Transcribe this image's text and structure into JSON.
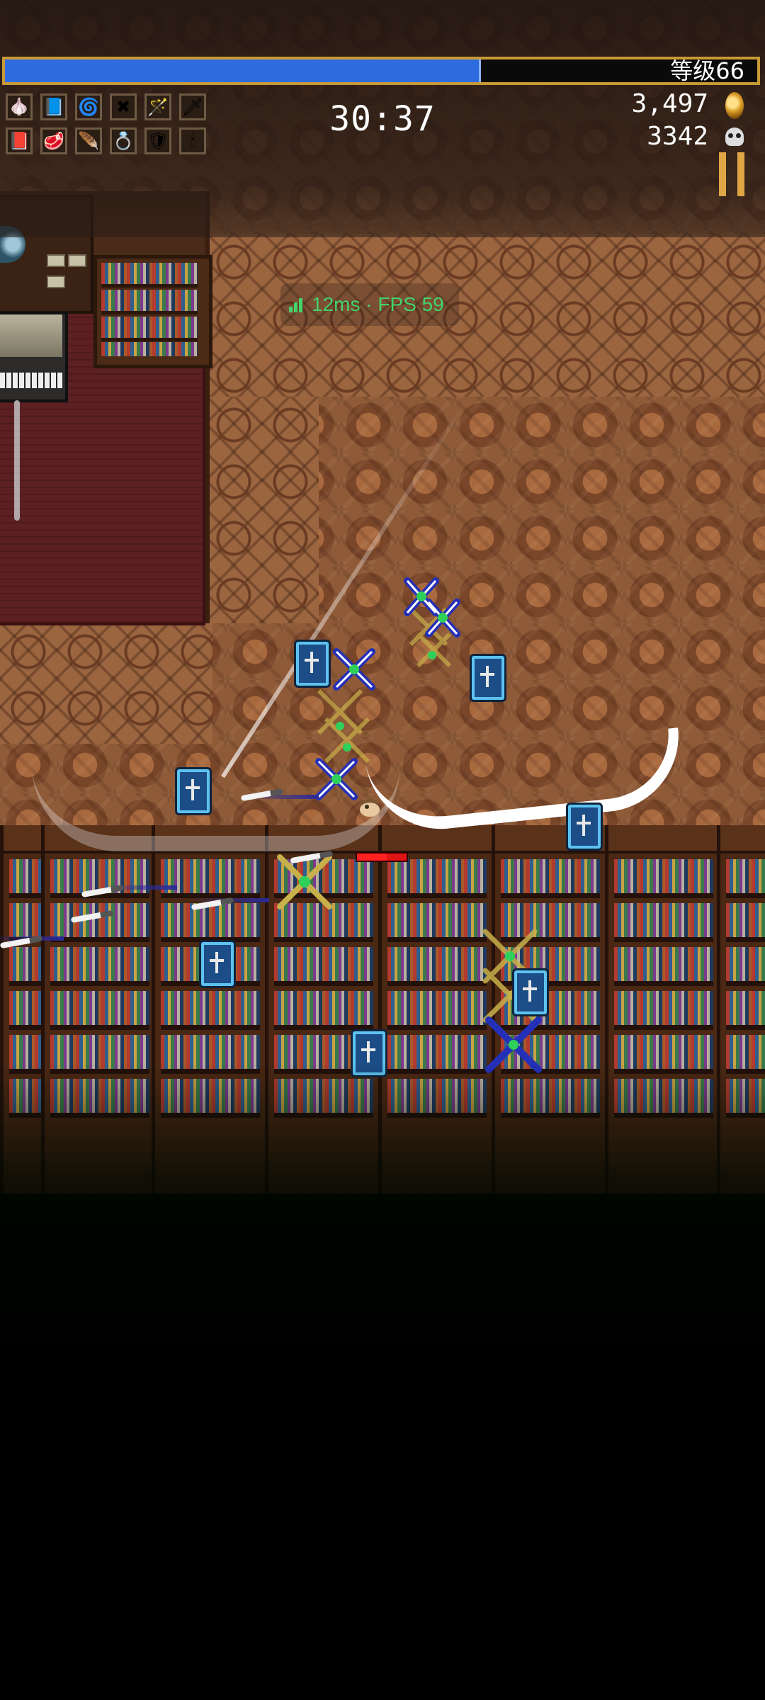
{
  "hud": {
    "xp_progress": 0.63,
    "level_text": "等级66",
    "timer": "30:37",
    "gold": "3,497",
    "kills": "3342",
    "weapons": [
      "garlic-icon",
      "king-bible-icon",
      "fire-ring-icon",
      "cross-icon",
      "magic-wand-icon",
      "knife-icon"
    ],
    "passives": [
      "red-tome-icon",
      "meat-icon",
      "feather-icon",
      "ring-icon",
      "armor-icon",
      "candelabra-icon"
    ]
  },
  "debug": {
    "ping_fps": "12ms · FPS 59"
  },
  "player": {
    "hp_fraction": 0.6
  }
}
